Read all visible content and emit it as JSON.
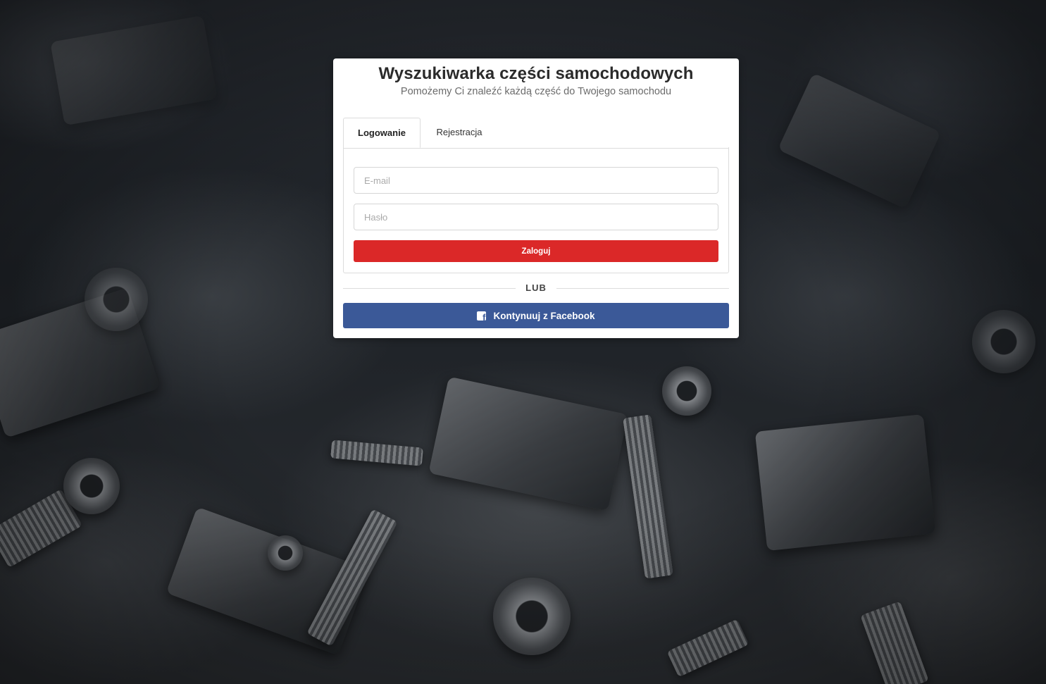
{
  "header": {
    "title": "Wyszukiwarka części samochodowych",
    "subtitle": "Pomożemy Ci znaleźć każdą część do Twojego samochodu"
  },
  "tabs": [
    {
      "label": "Logowanie",
      "active": true
    },
    {
      "label": "Rejestracja",
      "active": false
    }
  ],
  "login_form": {
    "email_placeholder": "E-mail",
    "email_value": "",
    "password_placeholder": "Hasło",
    "password_value": "",
    "submit_label": "Zaloguj"
  },
  "divider": {
    "label": "LUB"
  },
  "facebook": {
    "label": "Kontynuuj z Facebook",
    "icon": "facebook-icon"
  },
  "colors": {
    "primary_red": "#db2828",
    "facebook_blue": "#3b5998"
  }
}
